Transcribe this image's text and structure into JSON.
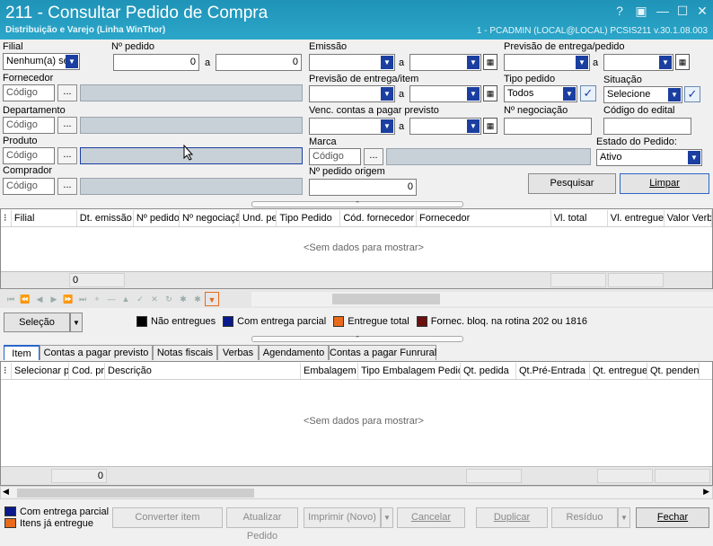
{
  "titlebar": {
    "title": "211 - Consultar Pedido de Compra",
    "subtitle": "Distribuição e Varejo (Linha WinThor)",
    "info": "1 - PCADMIN (LOCAL@LOCAL)   PCSIS211  v.30.1.08.003",
    "help": "?",
    "restore": "▣",
    "minimize": "—",
    "maximize": "☐",
    "close": "✕"
  },
  "filters": {
    "filial_label": "Filial",
    "filial_value": "Nenhum(a) se",
    "nro_pedido_label": "Nº pedido",
    "nro_pedido_from": "0",
    "a": "a",
    "nro_pedido_to": "0",
    "emissao_label": "Emissão",
    "prev_entrega_pedido_label": "Previsão de entrega/pedido",
    "fornecedor_label": "Fornecedor",
    "codigo_placeholder": "Código",
    "dots": "...",
    "prev_entrega_item_label": "Previsão de entrega/item",
    "tipo_pedido_label": "Tipo pedido",
    "tipo_pedido_value": "Todos",
    "situacao_label": "Situação",
    "situacao_value": "Selecione",
    "departamento_label": "Departamento",
    "venc_label": "Venc. contas a  pagar previsto",
    "nro_negociacao_label": "Nº negociação",
    "codigo_edital_label": "Código do edital",
    "produto_label": "Produto",
    "marca_label": "Marca",
    "estado_label": "Estado do Pedido:",
    "estado_value": "Ativo",
    "comprador_label": "Comprador",
    "nro_pedido_origem_label": "Nº pedido origem",
    "nro_pedido_origem_value": "0",
    "pesquisar": "Pesquisar",
    "limpar": "Limpar",
    "check": "✓",
    "calendar": "▦",
    "dropdown_arrow": "▼"
  },
  "grid1": {
    "columns": [
      "Filial",
      "Dt. emissão",
      "Nº pedido",
      "Nº negociaçã",
      "Und. pe",
      "Tipo Pedido",
      "Cód. fornecedor",
      "Fornecedor",
      "Vl. total",
      "Vl. entregue",
      "Valor Verba"
    ],
    "empty": "<Sem dados para mostrar>",
    "footer_count": "0"
  },
  "navbar": {
    "icons": [
      "⏮",
      "⏪",
      "◀",
      "▶",
      "⏩",
      "⏭",
      "+",
      "—",
      "▲",
      "✓",
      "✕",
      "↻",
      "✱",
      "✱",
      "▼"
    ]
  },
  "legend": {
    "selecao": "Seleção",
    "items": [
      {
        "label": "Não entregues",
        "color": "#000000"
      },
      {
        "label": "Com entrega parcial",
        "color": "#0a1a8a"
      },
      {
        "label": "Entregue total",
        "color": "#e86a1a"
      },
      {
        "label": "Fornec. bloq. na rotina 202 ou 1816",
        "color": "#6a1010"
      }
    ]
  },
  "tabs": [
    "Item",
    "Contas a pagar previsto",
    "Notas fiscais",
    "Verbas",
    "Agendamento",
    "Contas a pagar Funrural"
  ],
  "grid2": {
    "columns": [
      "Selecionar p",
      "Cod. pr",
      "Descrição",
      "Embalagem",
      "Tipo Embalagem Pedido",
      "Qt. pedida",
      "Qt.Pré-Entrada",
      "Qt. entregue",
      "Qt. pendent"
    ],
    "empty": "<Sem dados para mostrar>",
    "footer_count": "0"
  },
  "bottom": {
    "legend1": "Com entrega parcial",
    "legend1_color": "#0a1a8a",
    "legend2": "Itens já entregue",
    "legend2_color": "#e86a1a",
    "converter": "Converter item",
    "atualizar": "Atualizar Pedido",
    "imprimir": "Imprimir (Novo)",
    "cancelar": "Cancelar",
    "duplicar": "Duplicar",
    "residuo": "Resíduo",
    "fechar": "Fechar"
  },
  "scroll": {
    "left": "◀",
    "right": "▶",
    "up_grip": "⌃"
  }
}
